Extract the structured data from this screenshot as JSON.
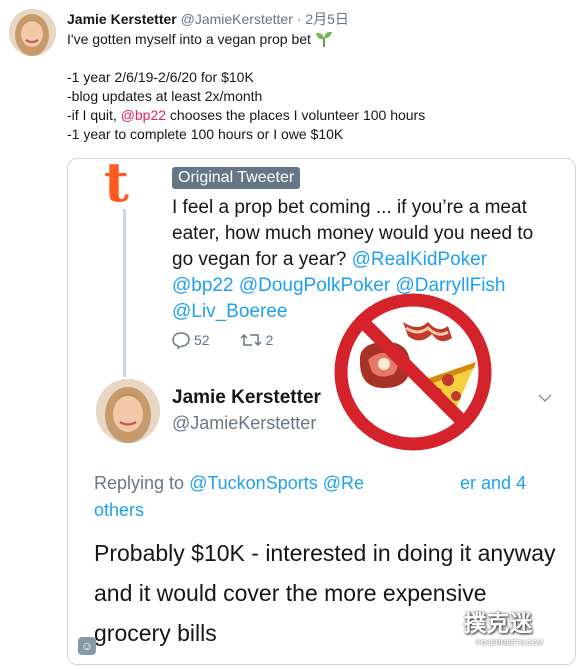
{
  "tweet": {
    "author_name": "Jamie Kerstetter",
    "author_handle": "@JamieKerstetter",
    "separator": "·",
    "date": "2月5日",
    "line1": "I've gotten myself into a vegan prop bet",
    "line2": "-1 year 2/6/19-2/6/20 for $10K",
    "line3": "-blog updates at least 2x/month",
    "line4_pre": "-if I quit, ",
    "line4_mention": "@bp22",
    "line4_post": " chooses the places I volunteer 100 hours",
    "line5": "-1 year to complete 100 hours or I owe $10K"
  },
  "embed": {
    "badge": "Original Tweeter",
    "text_l1": "I feel a prop bet coming ... if you’re a meat",
    "text_l2": "eater, how much money would you need to",
    "text_l3_pre": "go vegan for a year? ",
    "m1": "@RealKidPoker",
    "m2": "@bp22",
    "m3": "@DougPolkPoker",
    "m4": "@DarryllFish",
    "m5": "@Liv_Boeree",
    "replies": "52",
    "retweets": "2",
    "reply_name": "Jamie Kerstetter",
    "reply_handle": "@JamieKerstetter",
    "replying_to": "Replying to ",
    "replying_m1": "@TuckonSports",
    "replying_m2": "@Re",
    "replying_m3": "er and 4",
    "replying_others": "others",
    "reply_text": "Probably $10K - interested in doing it anyway and it would cover the more expensive grocery bills"
  },
  "watermark": {
    "text": "撲克迷",
    "sub": "POKERMEETS.COM"
  },
  "colors": {
    "mention_red": "#e0245e",
    "link_blue": "#1da1f2",
    "no_sign_red": "#d4232a",
    "logo_orange": "#ff5a1f"
  },
  "icons": [
    "sprout-icon",
    "reply-icon",
    "retweet-icon",
    "chevron-down-icon",
    "no-meat-icon"
  ]
}
